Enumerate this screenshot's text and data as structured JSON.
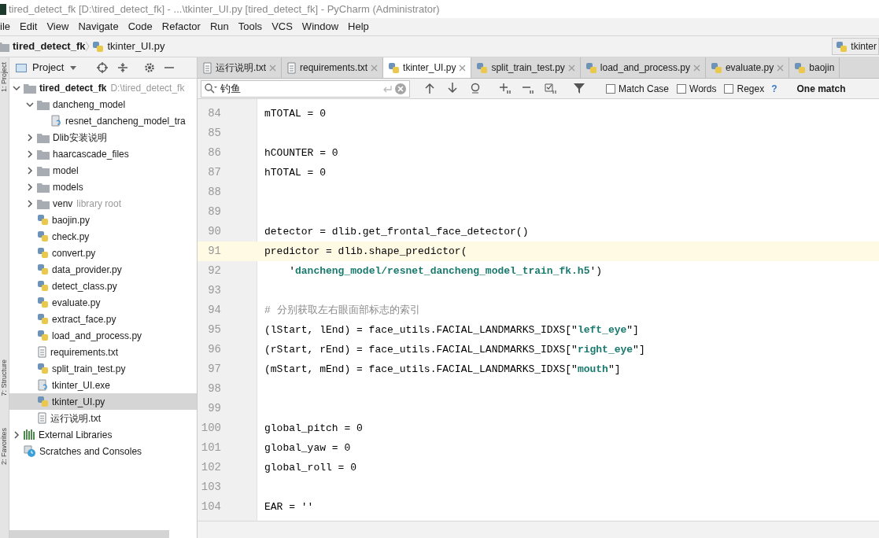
{
  "window": {
    "title": "tired_detect_fk [D:\\tired_detect_fk] - ...\\tkinter_UI.py [tired_detect_fk] - PyCharm (Administrator)"
  },
  "menu": [
    "ile",
    "Edit",
    "View",
    "Navigate",
    "Code",
    "Refactor",
    "Run",
    "Tools",
    "VCS",
    "Window",
    "Help"
  ],
  "breadcrumb": [
    {
      "label": "tired_detect_fk",
      "kind": "folder"
    },
    {
      "label": "tkinter_UI.py",
      "kind": "py"
    }
  ],
  "run_config": {
    "label": "tkinter"
  },
  "side_strip": [
    "1: Project",
    "7: Structure",
    "2: Favorites"
  ],
  "project_panel": {
    "title": "Project",
    "tree": [
      {
        "name": "tired_detect_fk",
        "kind": "folder",
        "hint": "D:\\tired_detect_fk",
        "expanded": true,
        "selected": false,
        "children": [
          {
            "name": "dancheng_model",
            "kind": "folder",
            "expanded": true,
            "selected": false,
            "children": [
              {
                "name": "resnet_dancheng_model_tra",
                "kind": "unknown",
                "selected": false
              }
            ]
          },
          {
            "name": "Dlib安装说明",
            "kind": "folder",
            "expanded": false,
            "selected": false
          },
          {
            "name": "haarcascade_files",
            "kind": "folder",
            "expanded": false,
            "selected": false
          },
          {
            "name": "model",
            "kind": "folder",
            "expanded": false,
            "selected": false
          },
          {
            "name": "models",
            "kind": "folder",
            "expanded": false,
            "selected": false
          },
          {
            "name": "venv",
            "kind": "folder",
            "hint": "library root",
            "expanded": false,
            "selected": false
          },
          {
            "name": "baojin.py",
            "kind": "py",
            "selected": false
          },
          {
            "name": "check.py",
            "kind": "py",
            "selected": false
          },
          {
            "name": "convert.py",
            "kind": "py",
            "selected": false
          },
          {
            "name": "data_provider.py",
            "kind": "py",
            "selected": false
          },
          {
            "name": "detect_class.py",
            "kind": "py",
            "selected": false
          },
          {
            "name": "evaluate.py",
            "kind": "py",
            "selected": false
          },
          {
            "name": "extract_face.py",
            "kind": "py",
            "selected": false
          },
          {
            "name": "load_and_process.py",
            "kind": "py",
            "selected": false
          },
          {
            "name": "requirements.txt",
            "kind": "txt",
            "selected": false
          },
          {
            "name": "split_train_test.py",
            "kind": "py",
            "selected": false
          },
          {
            "name": "tkinter_UI.exe",
            "kind": "unknown",
            "selected": false
          },
          {
            "name": "tkinter_UI.py",
            "kind": "py",
            "selected": true
          },
          {
            "name": "运行说明.txt",
            "kind": "txt",
            "selected": false
          }
        ]
      },
      {
        "name": "External Libraries",
        "kind": "libs",
        "expanded": false,
        "selected": false
      },
      {
        "name": "Scratches and Consoles",
        "kind": "scratch",
        "selected": false
      }
    ]
  },
  "tabs": [
    {
      "label": "运行说明.txt",
      "kind": "txt",
      "selected": false
    },
    {
      "label": "requirements.txt",
      "kind": "txt",
      "selected": false
    },
    {
      "label": "tkinter_UI.py",
      "kind": "py",
      "selected": true
    },
    {
      "label": "split_train_test.py",
      "kind": "py",
      "selected": false
    },
    {
      "label": "load_and_process.py",
      "kind": "py",
      "selected": false
    },
    {
      "label": "evaluate.py",
      "kind": "py",
      "selected": false
    },
    {
      "label": "baojin",
      "kind": "py",
      "selected": false
    }
  ],
  "find_bar": {
    "value": "钓鱼",
    "options": [
      {
        "label": "Match Case",
        "checked": false
      },
      {
        "label": "Words",
        "checked": false
      },
      {
        "label": "Regex",
        "checked": false
      }
    ],
    "help": "?",
    "result": "One match"
  },
  "code_lines": [
    {
      "number": "84",
      "kind": "code",
      "text": "mTOTAL = 0",
      "current": false
    },
    {
      "number": "85",
      "kind": "blank",
      "current": false
    },
    {
      "number": "86",
      "kind": "code",
      "text": "hCOUNTER = 0",
      "current": false
    },
    {
      "number": "87",
      "kind": "code",
      "text": "hTOTAL = 0",
      "current": false
    },
    {
      "number": "88",
      "kind": "blank",
      "current": false
    },
    {
      "number": "89",
      "kind": "blank",
      "current": false
    },
    {
      "number": "90",
      "kind": "code",
      "text": "detector = dlib.get_frontal_face_detector()",
      "current": false
    },
    {
      "number": "91",
      "kind": "code",
      "text": "predictor = dlib.shape_predictor(",
      "current": true
    },
    {
      "number": "92",
      "kind": "code",
      "text": "    '**dancheng_model/resnet_dancheng_model_train_fk.h5**')",
      "current": false
    },
    {
      "number": "93",
      "kind": "blank",
      "current": false
    },
    {
      "number": "94",
      "kind": "comment",
      "text": "# 分别获取左右眼面部标志的索引",
      "current": false
    },
    {
      "number": "95",
      "kind": "code",
      "text": "(lStart, lEnd) = face_utils.FACIAL_LANDMARKS_IDXS[\"**left_eye**\"]",
      "current": false
    },
    {
      "number": "96",
      "kind": "code",
      "text": "(rStart, rEnd) = face_utils.FACIAL_LANDMARKS_IDXS[\"**right_eye**\"]",
      "current": false
    },
    {
      "number": "97",
      "kind": "code",
      "text": "(mStart, mEnd) = face_utils.FACIAL_LANDMARKS_IDXS[\"**mouth**\"]",
      "current": false
    },
    {
      "number": "98",
      "kind": "blank",
      "current": false
    },
    {
      "number": "99",
      "kind": "blank",
      "current": false
    },
    {
      "number": "100",
      "kind": "code",
      "text": "global_pitch = 0",
      "current": false
    },
    {
      "number": "101",
      "kind": "code",
      "text": "global_yaw = 0",
      "current": false
    },
    {
      "number": "102",
      "kind": "code",
      "text": "global_roll = 0",
      "current": false
    },
    {
      "number": "103",
      "kind": "blank",
      "current": false
    },
    {
      "number": "104",
      "kind": "code",
      "text": "EAR = ''",
      "current": false
    }
  ]
}
